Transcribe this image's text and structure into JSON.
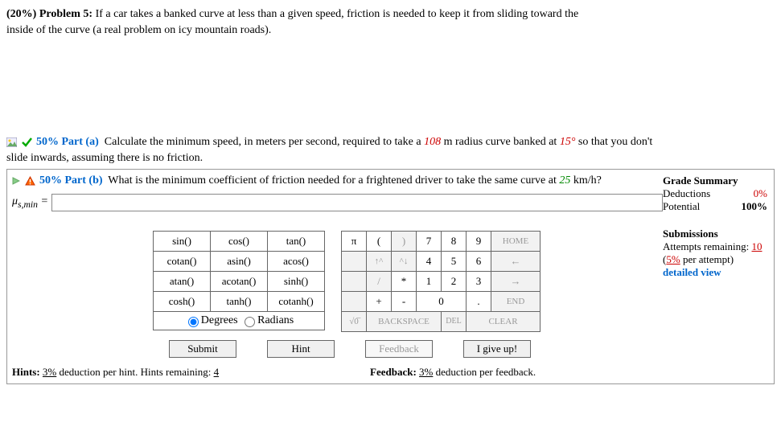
{
  "problem": {
    "percent": "(20%)",
    "label": "Problem 5:",
    "text1": "If a car takes a banked curve at less than a given speed, friction is needed to keep it from sliding toward the",
    "text2": "inside of the curve (a real problem on icy mountain roads)."
  },
  "partA": {
    "percent": "50%",
    "label": "Part (a)",
    "textBefore": "Calculate the minimum speed, in meters per second, required to take a ",
    "radius": "108",
    "textMid": " m radius curve banked at ",
    "angle": "15°",
    "textAfter": " so that you don't",
    "textLine2": "slide inwards, assuming there is no friction."
  },
  "partB": {
    "percent": "50%",
    "label": "Part (b)",
    "textBefore": "What is the minimum coefficient of friction needed for a frightened driver to take the same curve at ",
    "speed": "25",
    "textAfter": " km/h?"
  },
  "answerPrefix": "μ",
  "answerSub": "s,min",
  "answerEq": " = ",
  "grade": {
    "title": "Grade Summary",
    "deductionsLabel": "Deductions",
    "deductionsVal": "0%",
    "potentialLabel": "Potential",
    "potentialVal": "100%",
    "subTitle": "Submissions",
    "attemptsLabel": "Attempts remaining: ",
    "attemptsVal": "10",
    "perAttemptBefore": "(",
    "perAttemptVal": "5%",
    "perAttemptAfter": " per attempt)",
    "detailed": "detailed view"
  },
  "func": {
    "r1c1": "sin()",
    "r1c2": "cos()",
    "r1c3": "tan()",
    "r2c1": "cotan()",
    "r2c2": "asin()",
    "r2c3": "acos()",
    "r3c1": "atan()",
    "r3c2": "acotan()",
    "r3c3": "sinh()",
    "r4c1": "cosh()",
    "r4c2": "tanh()",
    "r4c3": "cotanh()",
    "degrees": "Degrees",
    "radians": "Radians"
  },
  "num": {
    "pi": "π",
    "lp": "(",
    "rp": ")",
    "n7": "7",
    "n8": "8",
    "n9": "9",
    "home": "HOME",
    "up": "↑^",
    "dn": "^↓",
    "n4": "4",
    "n5": "5",
    "n6": "6",
    "left": "←",
    "div": "/",
    "mul": "*",
    "n1": "1",
    "n2": "2",
    "n3": "3",
    "right": "→",
    "plus": "+",
    "minus": "-",
    "n0": "0",
    "dot": ".",
    "end": "END",
    "sqrt": "√0̅",
    "bksp": "BACKSPACE",
    "del": "DEL",
    "clear": "CLEAR"
  },
  "buttons": {
    "submit": "Submit",
    "hint": "Hint",
    "feedback": "Feedback",
    "giveup": "I give up!"
  },
  "footer": {
    "hintsLabel": "Hints: ",
    "hintsPct": "3%",
    "hintsMid": " deduction per hint. Hints remaining: ",
    "hintsRemain": "4",
    "feedbackLabel": "Feedback: ",
    "feedbackPct": "3%",
    "feedbackAfter": " deduction per feedback."
  }
}
